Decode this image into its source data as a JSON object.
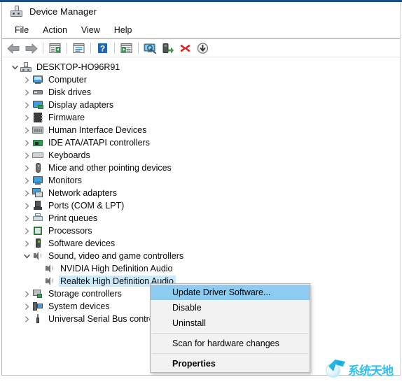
{
  "window": {
    "title": "Device Manager",
    "icon": "device-manager-icon"
  },
  "menubar": {
    "items": [
      {
        "label": "File"
      },
      {
        "label": "Action"
      },
      {
        "label": "View"
      },
      {
        "label": "Help"
      }
    ]
  },
  "toolbar": {
    "buttons": [
      {
        "name": "back-icon",
        "tooltip": "Back"
      },
      {
        "name": "forward-icon",
        "tooltip": "Forward"
      },
      {
        "name": "show-hide-console-tree-icon",
        "tooltip": "Show/Hide Console Tree"
      },
      {
        "name": "properties-icon",
        "tooltip": "Properties"
      },
      {
        "name": "help-icon",
        "tooltip": "Help"
      },
      {
        "name": "action-list-icon",
        "tooltip": "Action"
      },
      {
        "name": "scan-for-hardware-changes-icon",
        "tooltip": "Scan for hardware changes"
      },
      {
        "name": "update-driver-software-icon",
        "tooltip": "Update Driver Software"
      },
      {
        "name": "uninstall-device-icon",
        "tooltip": "Uninstall"
      },
      {
        "name": "disable-device-icon",
        "tooltip": "Disable"
      }
    ]
  },
  "tree": {
    "root": {
      "label": "DESKTOP-HO96R91",
      "expanded": true,
      "icon": "computer-root-icon"
    },
    "nodes": [
      {
        "label": "Computer",
        "icon": "computer-icon",
        "expanded": false,
        "depth": 1,
        "selected": false
      },
      {
        "label": "Disk drives",
        "icon": "disk-drive-icon",
        "expanded": false,
        "depth": 1,
        "selected": false
      },
      {
        "label": "Display adapters",
        "icon": "display-adapter-icon",
        "expanded": false,
        "depth": 1,
        "selected": false
      },
      {
        "label": "Firmware",
        "icon": "firmware-chip-icon",
        "expanded": false,
        "depth": 1,
        "selected": false
      },
      {
        "label": "Human Interface Devices",
        "icon": "hid-icon",
        "expanded": false,
        "depth": 1,
        "selected": false
      },
      {
        "label": "IDE ATA/ATAPI controllers",
        "icon": "ide-controller-icon",
        "expanded": false,
        "depth": 1,
        "selected": false
      },
      {
        "label": "Keyboards",
        "icon": "keyboard-icon",
        "expanded": false,
        "depth": 1,
        "selected": false
      },
      {
        "label": "Mice and other pointing devices",
        "icon": "mouse-icon",
        "expanded": false,
        "depth": 1,
        "selected": false
      },
      {
        "label": "Monitors",
        "icon": "monitor-icon",
        "expanded": false,
        "depth": 1,
        "selected": false
      },
      {
        "label": "Network adapters",
        "icon": "network-adapter-icon",
        "expanded": false,
        "depth": 1,
        "selected": false
      },
      {
        "label": "Ports (COM & LPT)",
        "icon": "port-icon",
        "expanded": false,
        "depth": 1,
        "selected": false
      },
      {
        "label": "Print queues",
        "icon": "printer-icon",
        "expanded": false,
        "depth": 1,
        "selected": false
      },
      {
        "label": "Processors",
        "icon": "processor-icon",
        "expanded": false,
        "depth": 1,
        "selected": false
      },
      {
        "label": "Software devices",
        "icon": "software-device-icon",
        "expanded": false,
        "depth": 1,
        "selected": false
      },
      {
        "label": "Sound, video and game controllers",
        "icon": "speaker-icon",
        "expanded": true,
        "depth": 1,
        "selected": false
      },
      {
        "label": "NVIDIA High Definition Audio",
        "icon": "speaker-icon",
        "expanded": null,
        "depth": 2,
        "selected": false
      },
      {
        "label": "Realtek High Definition Audio",
        "icon": "speaker-icon",
        "expanded": null,
        "depth": 2,
        "selected": true
      },
      {
        "label": "Storage controllers",
        "icon": "storage-controller-icon",
        "expanded": false,
        "depth": 1,
        "selected": false
      },
      {
        "label": "System devices",
        "icon": "system-device-icon",
        "expanded": false,
        "depth": 1,
        "selected": false
      },
      {
        "label": "Universal Serial Bus controllers",
        "icon": "usb-controller-icon",
        "expanded": false,
        "depth": 1,
        "selected": false
      }
    ]
  },
  "context_menu": {
    "items": [
      {
        "label": "Update Driver Software...",
        "highlighted": true,
        "bold": false,
        "type": "item"
      },
      {
        "label": "Disable",
        "highlighted": false,
        "bold": false,
        "type": "item"
      },
      {
        "label": "Uninstall",
        "highlighted": false,
        "bold": false,
        "type": "item"
      },
      {
        "type": "separator"
      },
      {
        "label": "Scan for hardware changes",
        "highlighted": false,
        "bold": false,
        "type": "item"
      },
      {
        "type": "separator"
      },
      {
        "label": "Properties",
        "highlighted": false,
        "bold": true,
        "type": "item"
      }
    ]
  },
  "watermark": {
    "text": "系统天地",
    "color": "#31bdec"
  },
  "colors": {
    "selection": "#cde8f8",
    "menu_highlight": "#8ecbf0",
    "title_accent": "#1c4e80",
    "menu_background": "#f2f2f2"
  }
}
